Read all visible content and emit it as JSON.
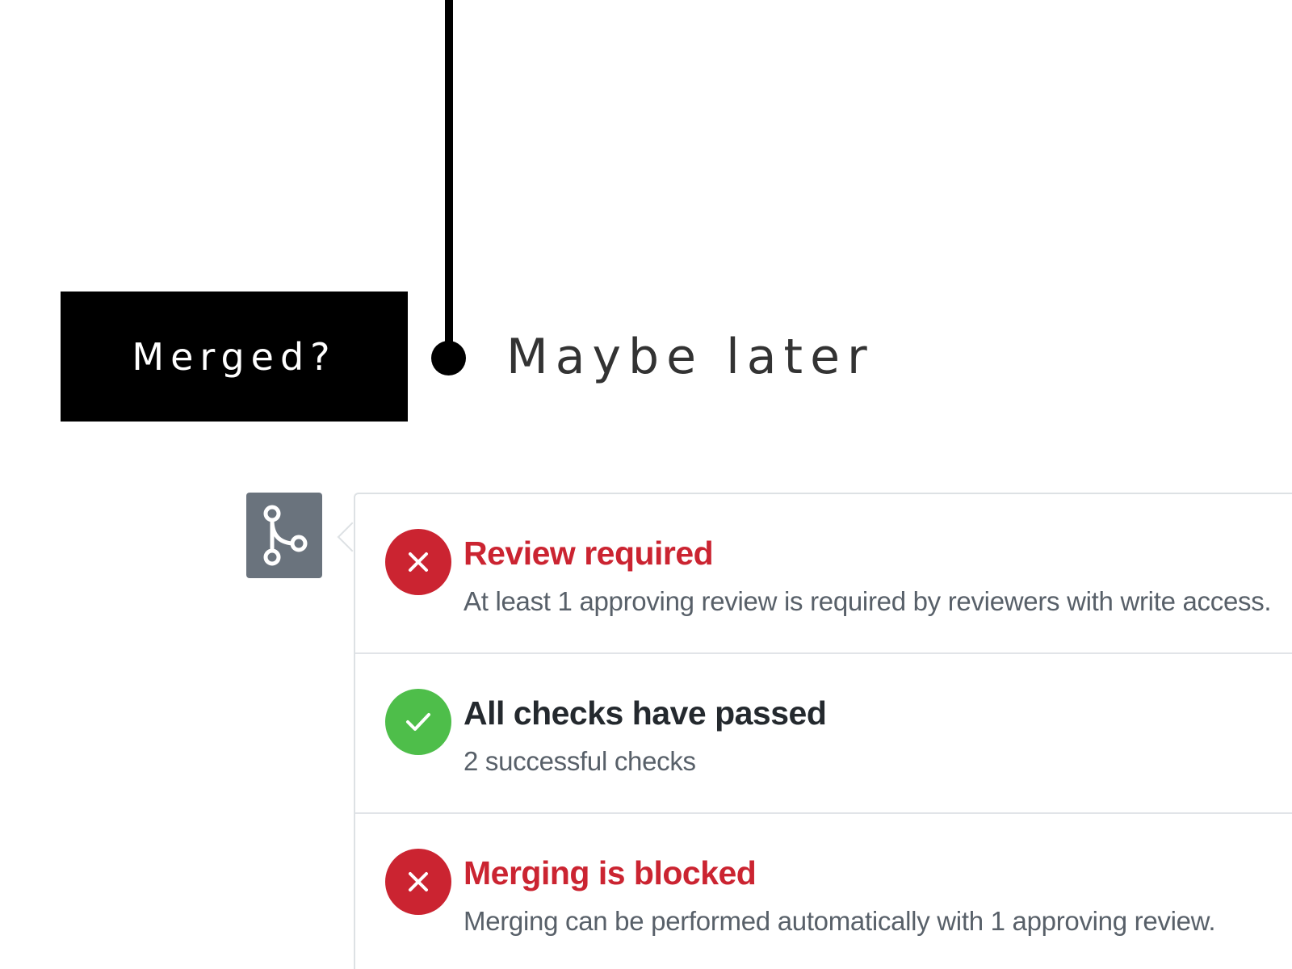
{
  "slide": {
    "merged_label": "Merged?",
    "maybe_later_label": "Maybe later"
  },
  "merge_panel": {
    "icon": "git-merge-icon",
    "rows": [
      {
        "status": "fail",
        "icon": "x-icon",
        "title": "Review required",
        "description": "At least 1 approving review is required by reviewers with write access."
      },
      {
        "status": "pass",
        "icon": "check-icon",
        "title": "All checks have passed",
        "description": "2 successful checks"
      },
      {
        "status": "fail",
        "icon": "x-icon",
        "title": "Merging is blocked",
        "description": "Merging can be performed automatically with 1 approving review."
      }
    ]
  },
  "colors": {
    "fail": "#cb2431",
    "pass": "#4ebe4a",
    "icon_box": "#6a737d",
    "slide_box": "#000000"
  }
}
